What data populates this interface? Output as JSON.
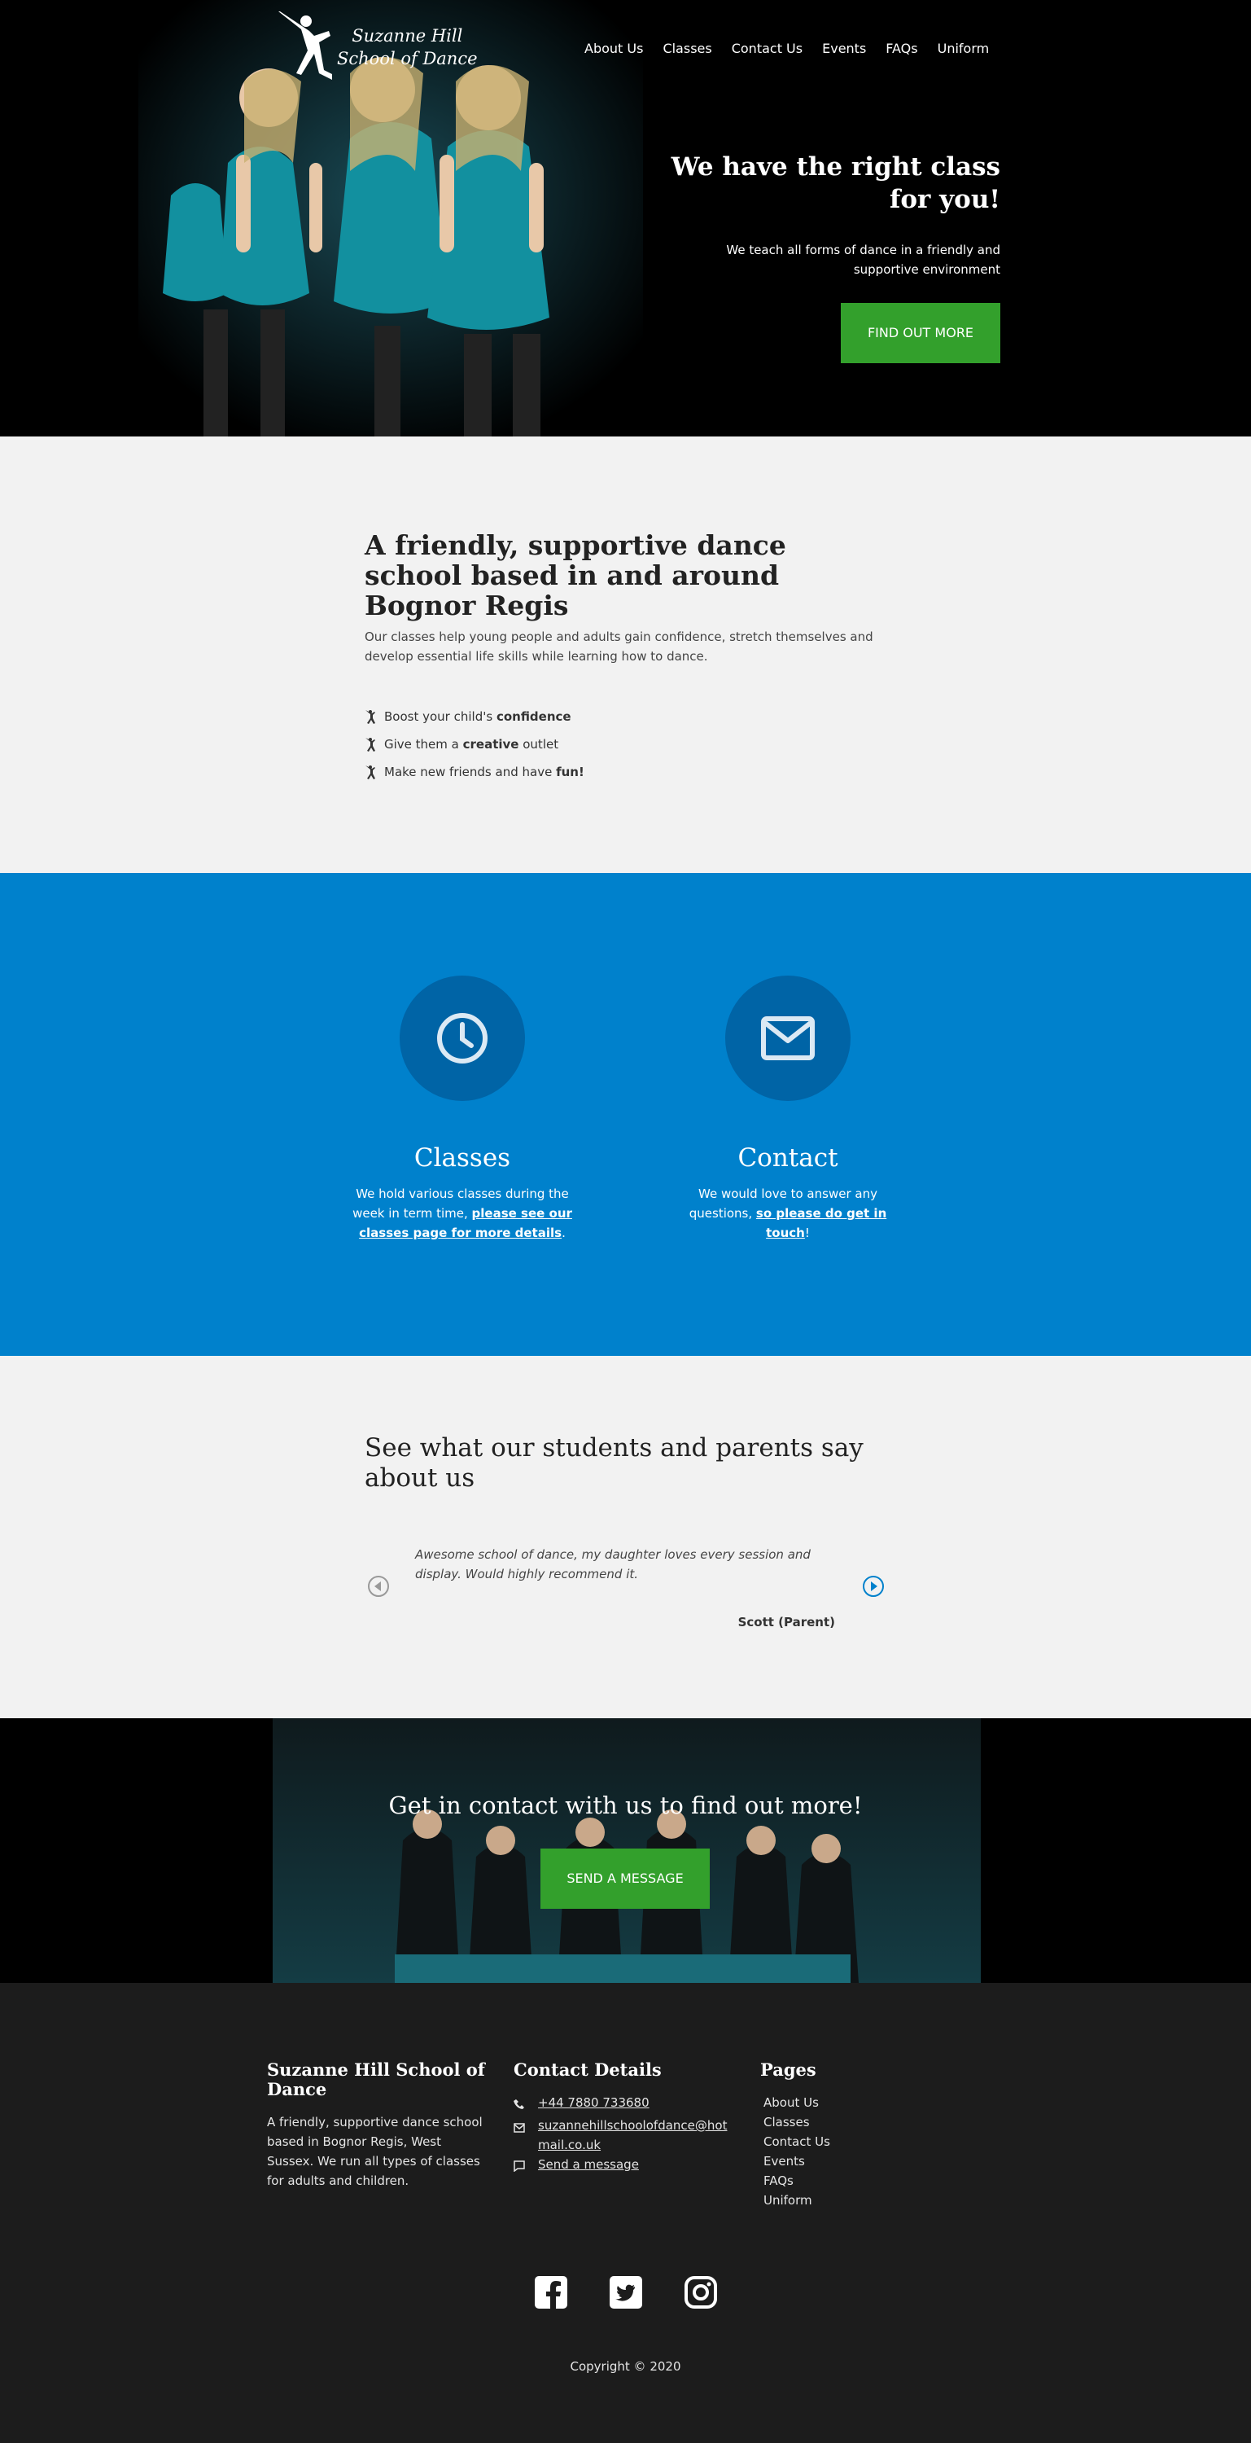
{
  "header": {
    "logo_line1": "Suzanne Hill",
    "logo_line2": "School of Dance",
    "nav": [
      "About Us",
      "Classes",
      "Contact Us",
      "Events",
      "FAQs",
      "Uniform"
    ]
  },
  "hero": {
    "title": "We have the right class for you!",
    "subtitle": "We teach all forms of dance in a friendly and supportive environment",
    "button": "FIND OUT MORE"
  },
  "intro": {
    "title": "A friendly, supportive dance school based in and around Bognor Regis",
    "body": "Our classes help young people and adults gain confidence, stretch themselves and develop essential life skills while learning how to dance.",
    "benefits": [
      {
        "prefix": "Boost your child's ",
        "bold": "confidence",
        "suffix": ""
      },
      {
        "prefix": "Give them a ",
        "bold": "creative",
        "suffix": " outlet"
      },
      {
        "prefix": "Make new friends and have ",
        "bold": "fun!",
        "suffix": ""
      }
    ]
  },
  "features": {
    "classes": {
      "icon": "clock-icon",
      "title": "Classes",
      "text": "We hold various classes during the week in term time, ",
      "link": "please see our classes page for more details",
      "end": "."
    },
    "contact": {
      "icon": "envelope-icon",
      "title": "Contact",
      "text": "We would love to answer any questions, ",
      "link": "so please do get in touch",
      "end": "!"
    },
    "bg_color": "#0081cc"
  },
  "testimonials": {
    "title": "See what our students and parents say about us",
    "quote": "Awesome school of dance, my daughter loves every session and display. Would highly recommend it.",
    "author": "Scott (Parent)"
  },
  "cta": {
    "title": "Get in contact with us to find out more!",
    "button": "SEND A MESSAGE"
  },
  "footer": {
    "about_title": "Suzanne Hill School of Dance",
    "about_text": "A friendly, supportive dance school based in Bognor Regis, West Sussex. We run all types of classes for adults and children.",
    "contact_title": "Contact Details",
    "phone": "+44 7880 733680",
    "email_line1": "suzannehillschoolofdance@hot",
    "email_line2": "mail.co.uk",
    "message": "Send a message",
    "pages_title": "Pages",
    "pages": [
      "About Us",
      "Classes",
      "Contact Us",
      "Events",
      "FAQs",
      "Uniform"
    ],
    "social_icons": [
      "facebook-icon",
      "twitter-icon",
      "instagram-icon"
    ],
    "copyright": "Copyright © 2020"
  },
  "colors": {
    "green": "#33a02c",
    "blue": "#0081cc",
    "dark_blue": "#0064a6",
    "footer": "#1c1c1c"
  }
}
